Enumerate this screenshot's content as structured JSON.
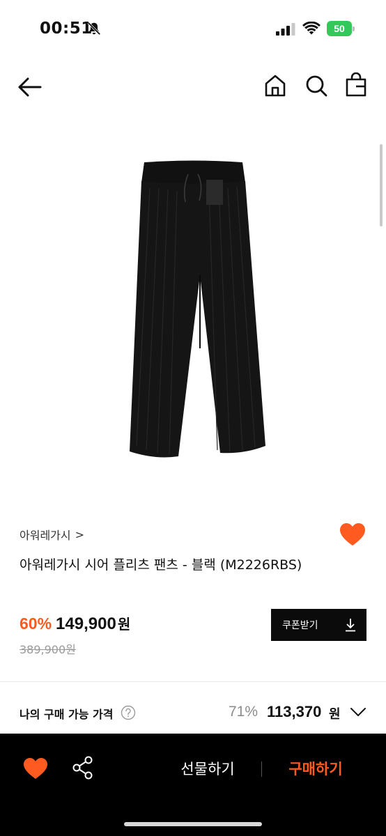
{
  "status_bar": {
    "time": "00:51",
    "battery": "50"
  },
  "nav": {
    "icons": [
      "back-arrow-icon",
      "home-icon",
      "search-icon",
      "shopping-bag-icon"
    ]
  },
  "product": {
    "brand": "아워레가시",
    "brand_chevron": ">",
    "name": "아워레가시 시어 플리츠 팬츠 - 블랙 (M2226RBS)",
    "discount": "60%",
    "price": "149,900",
    "price_unit": "원",
    "original_price": "389,900원",
    "coupon_label": "쿠폰받기"
  },
  "my_price": {
    "label": "나의 구매 가능 가격",
    "discount": "71%",
    "price": "113,370",
    "unit": "원"
  },
  "bottom_bar": {
    "gift_label": "선물하기",
    "buy_label": "구매하기"
  },
  "colors": {
    "accent": "#ff5a1f",
    "bottom_bar": "#000000",
    "battery": "#34c759"
  }
}
